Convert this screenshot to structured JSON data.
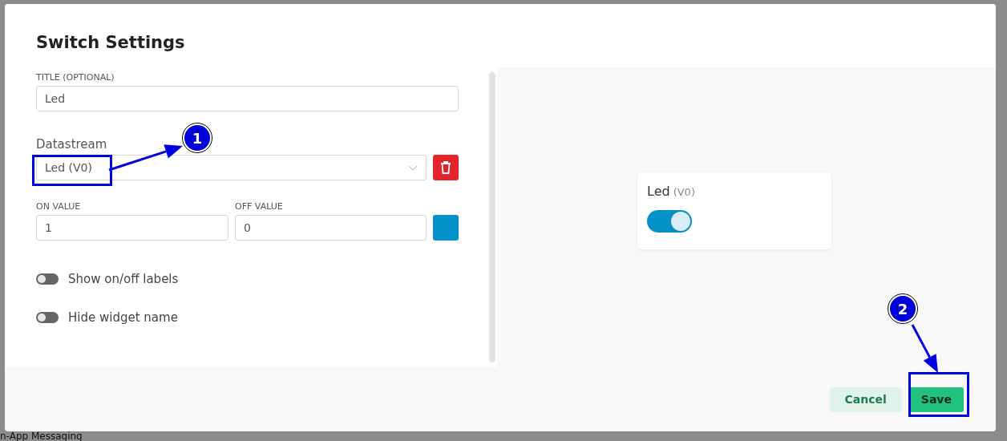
{
  "background": {
    "sidebar_item": "n-App Messaging"
  },
  "dialog": {
    "title": "Switch Settings",
    "fields": {
      "title_label": "TITLE (OPTIONAL)",
      "title_value": "Led",
      "datastream_label": "Datastream",
      "datastream_value": "Led (V0)",
      "on_label": "ON VALUE",
      "on_value": "1",
      "off_label": "OFF VALUE",
      "off_value": "0"
    },
    "toggles": [
      {
        "label": "Show on/off labels",
        "on": false
      },
      {
        "label": "Hide widget name",
        "on": false
      }
    ],
    "preview": {
      "name": "Led",
      "pin": "(V0)",
      "on": true
    },
    "buttons": [
      {
        "label": "Cancel",
        "kind": "secondary"
      },
      {
        "label": "Save",
        "kind": "primary"
      }
    ]
  },
  "annotations": [
    {
      "label": "1"
    },
    {
      "label": "2"
    }
  ]
}
